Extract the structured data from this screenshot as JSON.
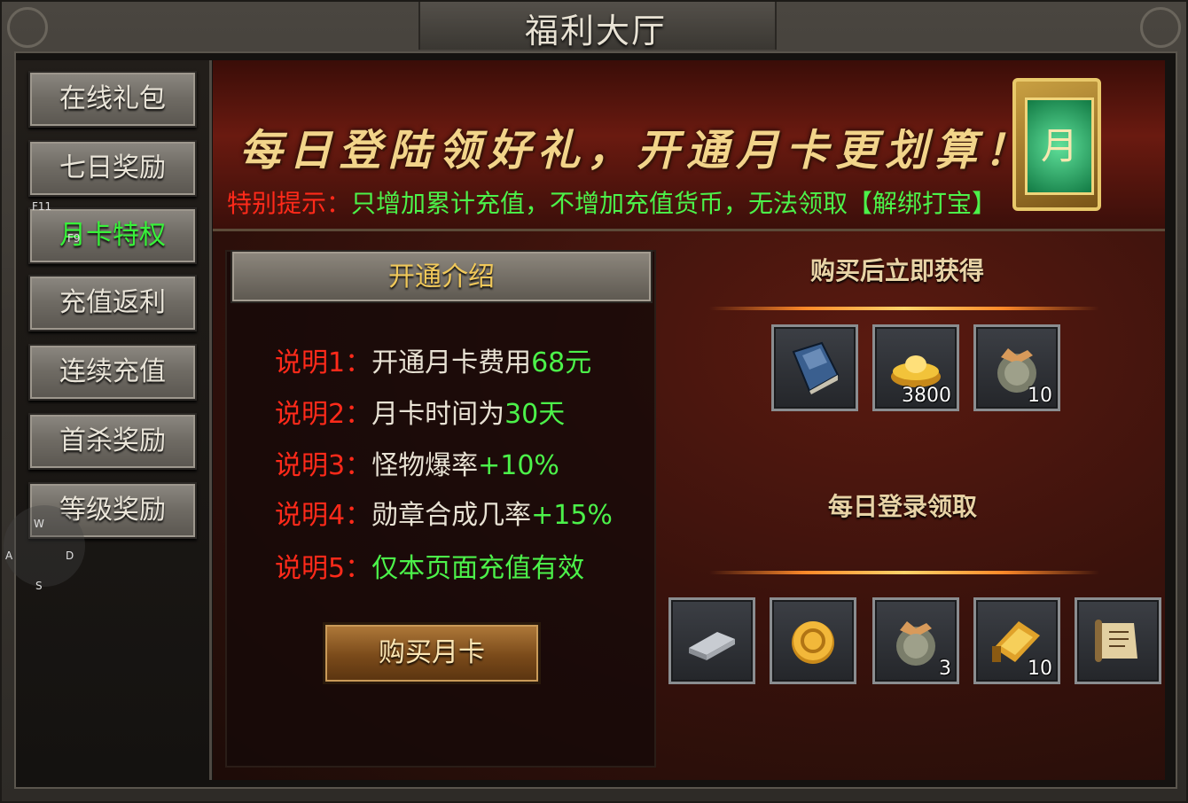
{
  "window": {
    "title": "福利大厅"
  },
  "sidebar": {
    "items": [
      {
        "label": "在线礼包",
        "active": false
      },
      {
        "label": "七日奖励",
        "active": false
      },
      {
        "label": "月卡特权",
        "active": true
      },
      {
        "label": "充值返利",
        "active": false
      },
      {
        "label": "连续充值",
        "active": false
      },
      {
        "label": "首杀奖励",
        "active": false
      },
      {
        "label": "等级奖励",
        "active": false
      }
    ]
  },
  "hotkeys": {
    "f11": "F11",
    "f9": "F9",
    "w": "W",
    "a": "A",
    "s": "S",
    "d": "D"
  },
  "banner": {
    "slogan": "每日登陆领好礼，开通月卡更划算！",
    "notice_label": "特别提示：",
    "notice_text": "只增加累计充值，不增加充值货币，无法领取【解绑打宝】",
    "card_char": "月"
  },
  "intro": {
    "header": "开通介绍",
    "lines": [
      {
        "key": "说明1：",
        "text": "开通月卡费用",
        "value": "68元"
      },
      {
        "key": "说明2：",
        "text": "月卡时间为",
        "value": "30天"
      },
      {
        "key": "说明3：",
        "text": "怪物爆率",
        "value": "+10%"
      },
      {
        "key": "说明4：",
        "text": "勋章合成几率",
        "value": "+15%"
      },
      {
        "key": "说明5：",
        "text": "",
        "value": "仅本页面充值有效"
      }
    ],
    "buy_label": "购买月卡"
  },
  "rewards": {
    "instant_title": "购买后立即获得",
    "instant_items": [
      {
        "icon": "book-icon",
        "count": ""
      },
      {
        "icon": "gold-ingot-icon",
        "count": "3800"
      },
      {
        "icon": "pouch-icon",
        "count": "10"
      }
    ],
    "daily_title": "每日登录领取",
    "daily_items": [
      {
        "icon": "silver-bar-icon",
        "count": ""
      },
      {
        "icon": "gold-coin-icon",
        "count": ""
      },
      {
        "icon": "pouch-icon",
        "count": "3"
      },
      {
        "icon": "golden-scroll-icon",
        "count": "10"
      },
      {
        "icon": "parchment-scroll-icon",
        "count": ""
      }
    ]
  },
  "colors": {
    "active_green": "#38f23a",
    "warning_red": "#ff2a1a",
    "value_green": "#4cf24a",
    "gold": "#f0c85a"
  }
}
